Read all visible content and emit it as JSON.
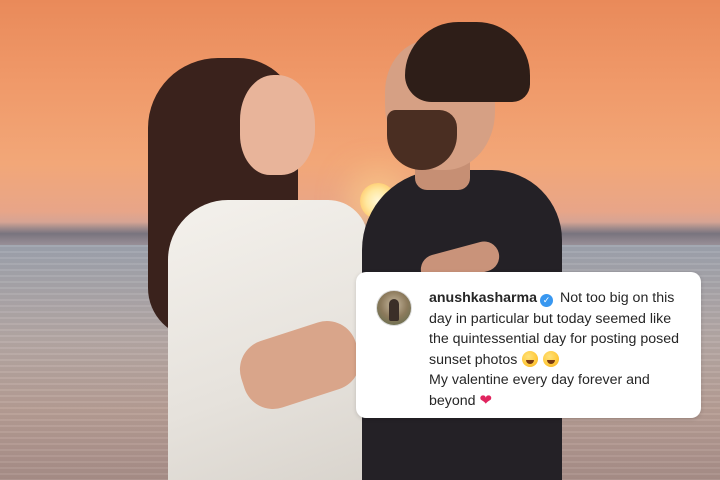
{
  "photo": {
    "description_icons": [
      "sun",
      "couple",
      "sea"
    ]
  },
  "comment": {
    "username": "anushkasharma",
    "verified_icon": "verified-badge-icon",
    "text_line1": "Not too big on this day in particular but today seemed like the quintessential day for posting posed sunset photos",
    "emoji1": "zany-face-emoji",
    "emoji2": "laughing-face-emoji",
    "text_line2": "My valentine every day forever and beyond",
    "heart": "❤",
    "colors": {
      "verified_badge": "#3897f0",
      "heart": "#e0245e",
      "text": "#262626"
    }
  }
}
